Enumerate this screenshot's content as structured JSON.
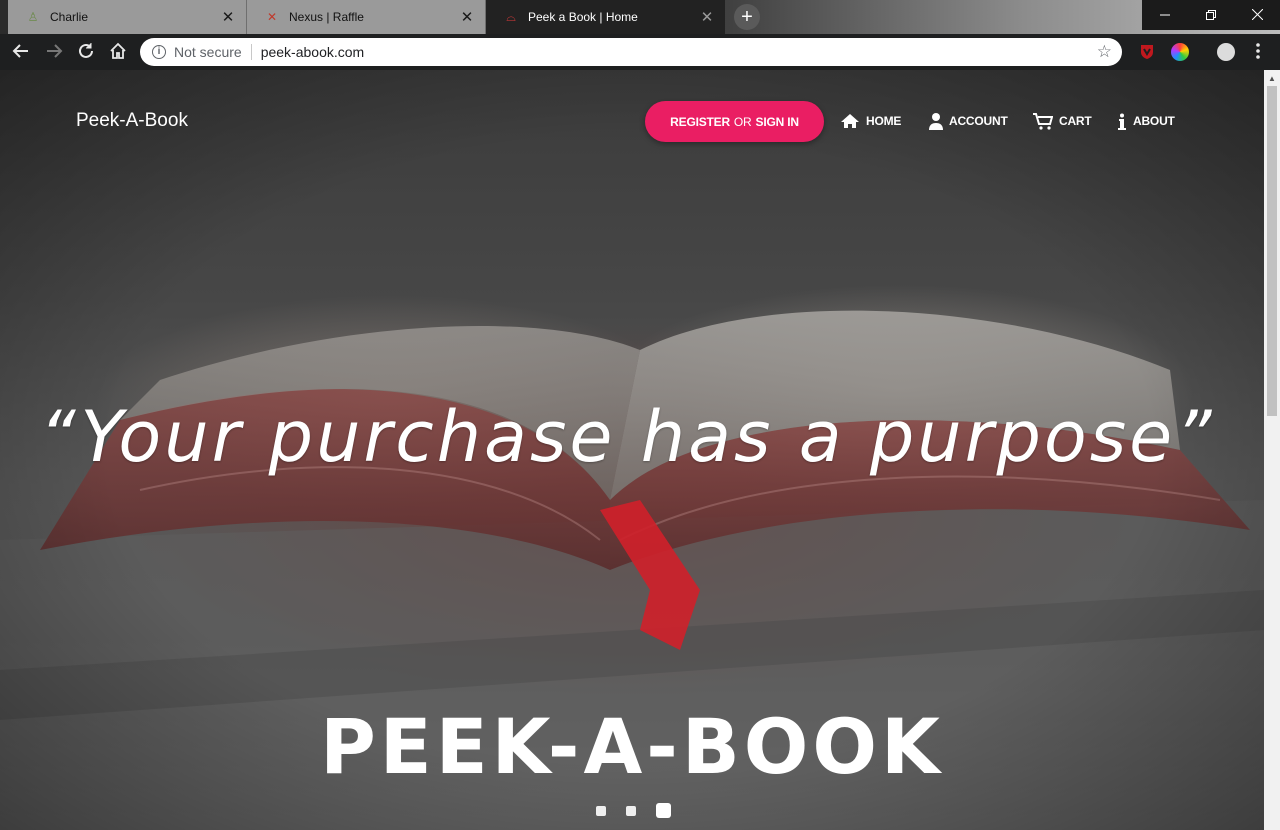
{
  "browser": {
    "tabs": [
      {
        "title": "Charlie",
        "icon": "charlie-favicon",
        "active": false
      },
      {
        "title": "Nexus | Raffle",
        "icon": "nexus-favicon",
        "active": false
      },
      {
        "title": "Peek a Book | Home",
        "icon": "book-favicon",
        "active": true
      }
    ],
    "close_glyph": "✕",
    "new_tab_glyph": "+",
    "security_label": "Not secure",
    "url": "peek-abook.com"
  },
  "site": {
    "brand": "Peek-A-Book",
    "register_label": "REGISTER",
    "or_label": "OR",
    "signin_label": "SIGN IN",
    "nav": {
      "home": "HOME",
      "account": "ACCOUNT",
      "cart": "CART",
      "about": "ABOUT"
    },
    "quote": "“Your purchase has a purpose”",
    "hero_title": "PEEK-A-BOOK",
    "accent_color": "#ea1e63",
    "carousel": {
      "slide_count": 3,
      "active_index": 3
    }
  }
}
